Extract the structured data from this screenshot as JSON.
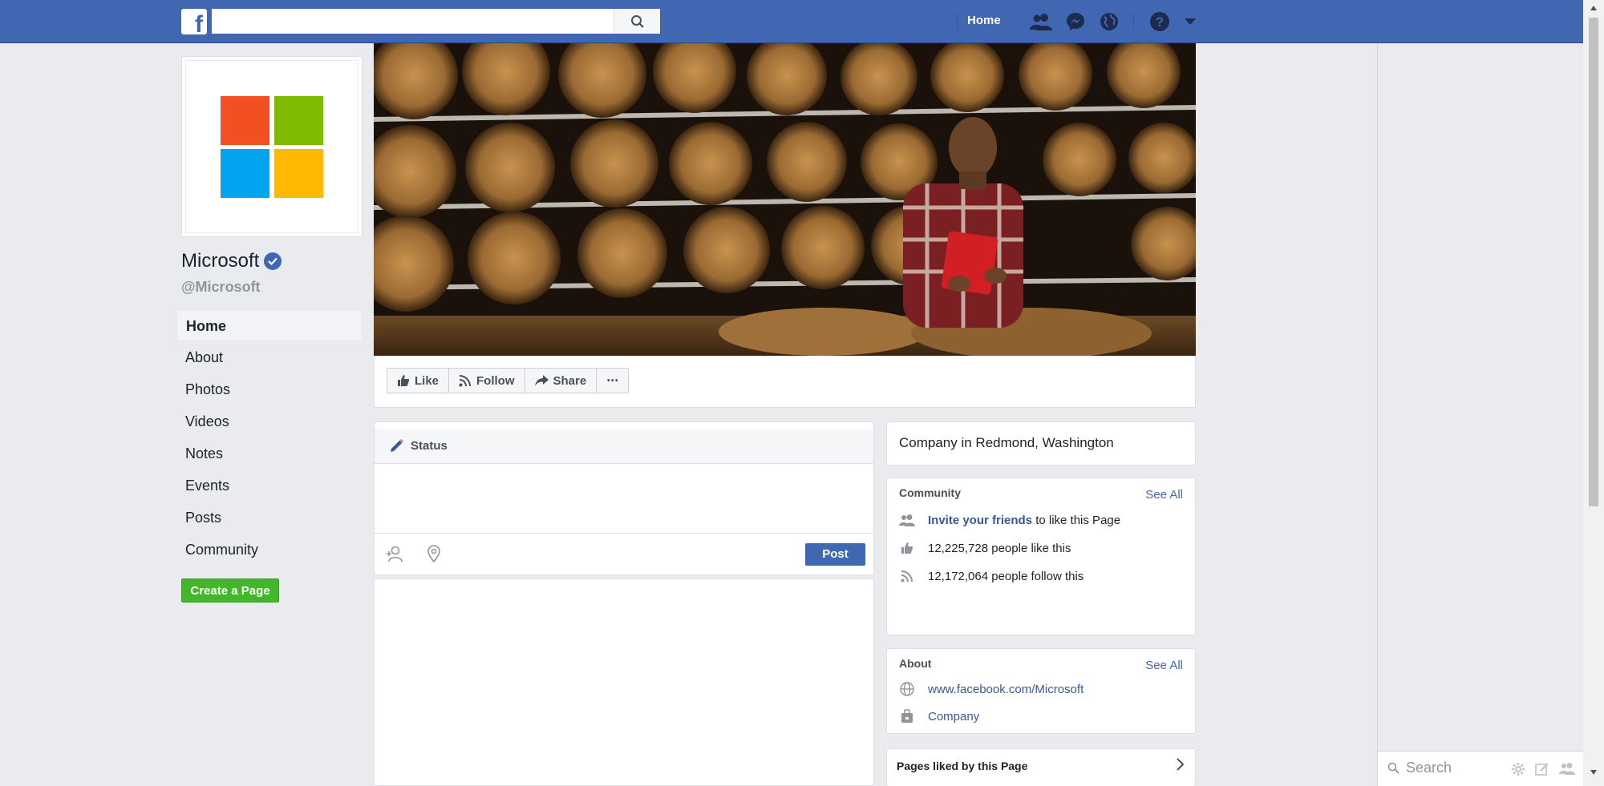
{
  "topbar": {
    "logo": "f",
    "search_placeholder": "",
    "home_label": "Home",
    "icons": [
      "search-icon",
      "friends-icon",
      "messenger-icon",
      "globe-icon",
      "help-icon",
      "caret-down-icon"
    ]
  },
  "page": {
    "name": "Microsoft",
    "handle": "@Microsoft",
    "verified": true,
    "logo_colors": [
      "#f25022",
      "#7fba00",
      "#00a4ef",
      "#ffb900"
    ]
  },
  "left_nav": {
    "items": [
      {
        "label": "Home",
        "active": true
      },
      {
        "label": "About"
      },
      {
        "label": "Photos"
      },
      {
        "label": "Videos"
      },
      {
        "label": "Notes"
      },
      {
        "label": "Events"
      },
      {
        "label": "Posts"
      },
      {
        "label": "Community"
      }
    ],
    "create_page_label": "Create a Page"
  },
  "actions": {
    "like": "Like",
    "follow": "Follow",
    "share": "Share",
    "more": "···"
  },
  "composer": {
    "tab_label": "Status",
    "post_label": "Post"
  },
  "category_card": {
    "text": "Company in Redmond, Washington"
  },
  "community_card": {
    "title": "Community",
    "see_all": "See All",
    "invite_link": "Invite your friends",
    "invite_rest": " to like this Page",
    "likes": "12,225,728 people like this",
    "follows": "12,172,064 people follow this"
  },
  "about_card": {
    "title": "About",
    "see_all": "See All",
    "website": "www.facebook.com/Microsoft",
    "category": "Company"
  },
  "pages_liked": {
    "title": "Pages liked by this Page"
  },
  "chat": {
    "search_placeholder": "Search"
  },
  "colors": {
    "brand": "#4267b2",
    "link": "#385898",
    "create_green": "#42b72a"
  }
}
